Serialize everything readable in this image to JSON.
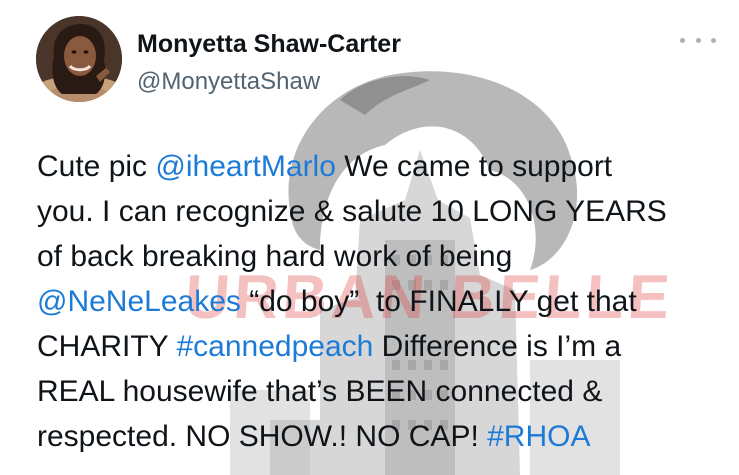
{
  "user": {
    "display_name": "Monyetta Shaw-Carter",
    "handle": "@MonyettaShaw",
    "avatar": "profile-photo"
  },
  "menu_icon": "more-horizontal-icon",
  "watermark": {
    "text": "URBAN BELLE"
  },
  "tweet": {
    "lines": [
      [
        {
          "type": "text",
          "text": "Cute pic "
        },
        {
          "type": "mention",
          "text": "@iheartMarlo"
        },
        {
          "type": "text",
          "text": " We came to support"
        }
      ],
      [
        {
          "type": "text",
          "text": "you. I can recognize & salute 10 LONG YEARS"
        }
      ],
      [
        {
          "type": "text",
          "text": "of back breaking hard work of being"
        }
      ],
      [
        {
          "type": "mention",
          "text": "@NeNeLeakes"
        },
        {
          "type": "text",
          "text": " “do boy”  to FINALLY get that"
        }
      ],
      [
        {
          "type": "text",
          "text": "CHARITY "
        },
        {
          "type": "hashtag",
          "text": "#cannedpeach"
        },
        {
          "type": "text",
          "text": " Difference is I’m a"
        }
      ],
      [
        {
          "type": "text",
          "text": "REAL housewife that’s BEEN connected &"
        }
      ],
      [
        {
          "type": "text",
          "text": "respected. NO SHOW.! NO CAP! "
        },
        {
          "type": "hashtag",
          "text": "#RHOA"
        }
      ]
    ]
  },
  "colors": {
    "link": "#1d7bd8",
    "text": "#0f1419",
    "secondary": "#536471",
    "watermark_red": "#e13c3c"
  }
}
